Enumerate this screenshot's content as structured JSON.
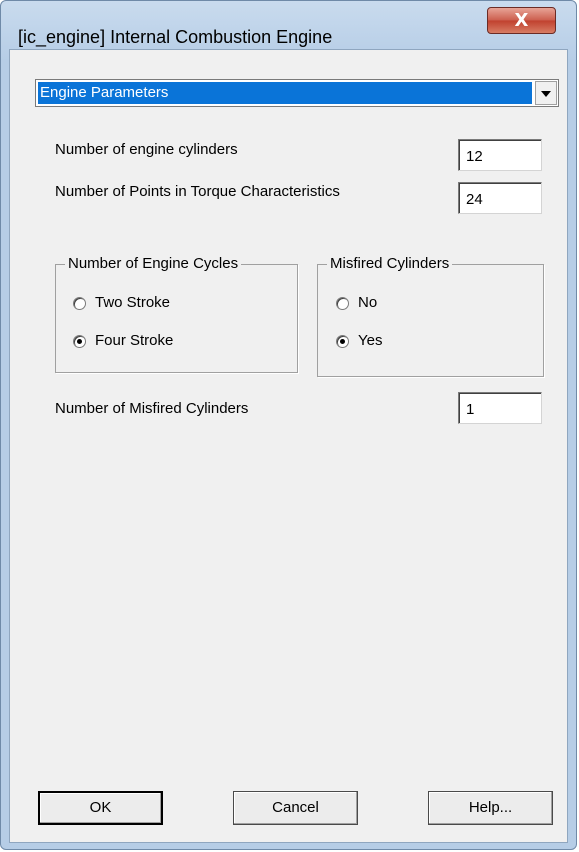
{
  "window": {
    "title": "[ic_engine] Internal Combustion Engine",
    "close_glyph": "X"
  },
  "section_select": {
    "value": "Engine Parameters"
  },
  "fields": {
    "cylinders": {
      "label": "Number of engine cylinders",
      "value": "12"
    },
    "torque_points": {
      "label": "Number of Points in Torque Characteristics",
      "value": "24"
    },
    "misfired_count": {
      "label": "Number of Misfired Cylinders",
      "value": "1"
    }
  },
  "engine_cycles": {
    "title": "Number of Engine Cycles",
    "options": [
      {
        "label": "Two Stroke",
        "checked": false
      },
      {
        "label": "Four Stroke",
        "checked": true
      }
    ]
  },
  "misfired": {
    "title": "Misfired Cylinders",
    "options": [
      {
        "label": "No",
        "checked": false
      },
      {
        "label": "Yes",
        "checked": true
      }
    ]
  },
  "buttons": {
    "ok": "OK",
    "cancel": "Cancel",
    "help": "Help..."
  }
}
